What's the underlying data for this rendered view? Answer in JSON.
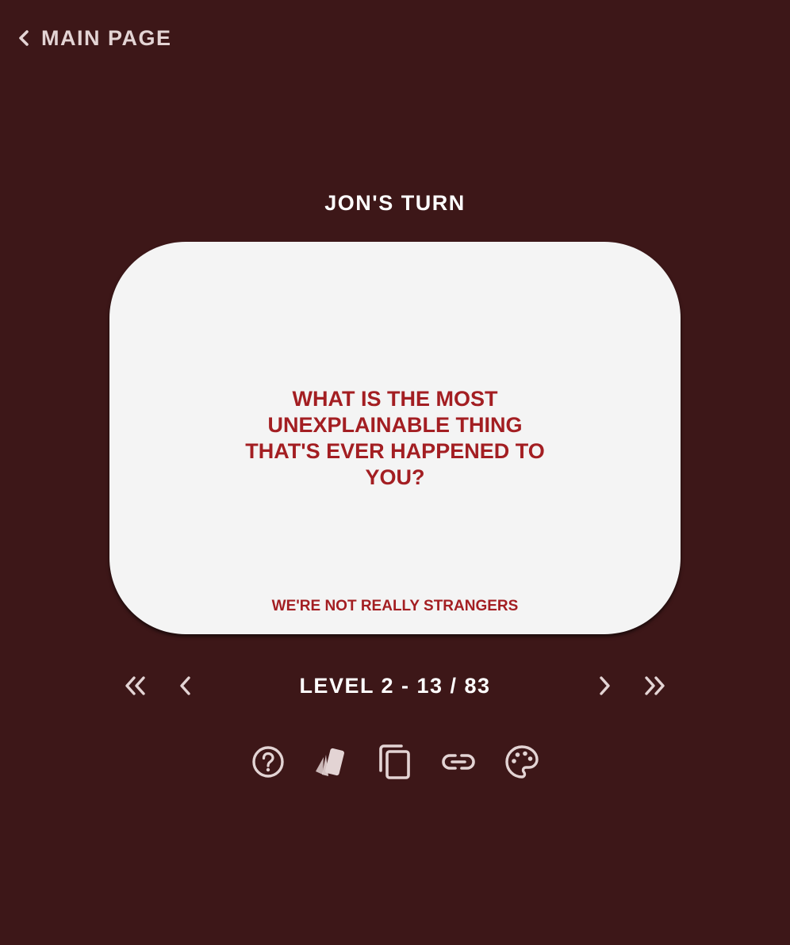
{
  "header": {
    "back_label": "MAIN PAGE",
    "back_icon": "chevron-left-icon"
  },
  "turn": {
    "label": "JON'S TURN"
  },
  "card": {
    "question": "WHAT IS THE MOST UNEXPLAINABLE THING THAT'S EVER HAPPENED TO YOU?",
    "deck_name": "WE'RE NOT REALLY STRANGERS"
  },
  "navigation": {
    "level_text": "LEVEL 2 - 13 / 83",
    "first_icon": "double-chevron-left-icon",
    "prev_icon": "chevron-left-icon",
    "next_icon": "chevron-right-icon",
    "last_icon": "double-chevron-right-icon"
  },
  "toolbar": {
    "items": [
      {
        "icon": "help-icon"
      },
      {
        "icon": "cards-icon"
      },
      {
        "icon": "copy-icon"
      },
      {
        "icon": "link-icon"
      },
      {
        "icon": "palette-icon"
      }
    ]
  },
  "colors": {
    "background": "#3d1718",
    "card": "#f4f4f4",
    "accent": "#a31e22",
    "icon": "#e3d4d4",
    "title": "#ffffff"
  }
}
